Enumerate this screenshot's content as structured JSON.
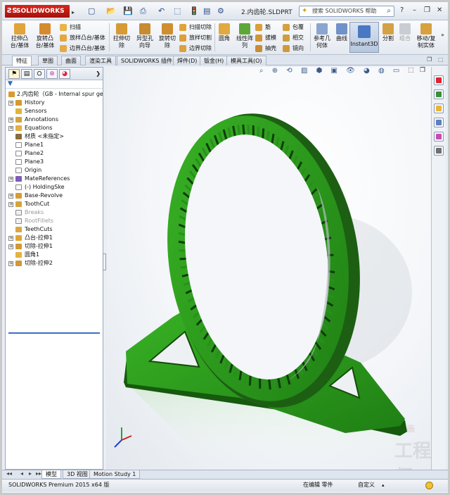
{
  "app": {
    "brand": "SOLIDWORKS",
    "file_title": "2.内齿轮.SLDPRT",
    "search_placeholder": "搜索 SOLIDWORKS 帮助"
  },
  "command_manager": {
    "buttons": [
      {
        "label": "拉伸凸\n台/基体",
        "icon": "extrude-boss-icon"
      },
      {
        "label": "旋转凸\n台/基体",
        "icon": "revolve-boss-icon"
      },
      {
        "label": "扫描",
        "icon": "sweep-icon"
      },
      {
        "label": "放样凸台/基体",
        "icon": "loft-icon"
      },
      {
        "label": "边界凸台/基体",
        "icon": "boundary-boss-icon"
      },
      {
        "label": "拉伸切\n除",
        "icon": "extrude-cut-icon"
      },
      {
        "label": "异型孔\n向导",
        "icon": "hole-wizard-icon"
      },
      {
        "label": "旋转切\n除",
        "icon": "revolve-cut-icon"
      },
      {
        "label": "扫描切除",
        "icon": "swept-cut-icon"
      },
      {
        "label": "放样切割",
        "icon": "lofted-cut-icon"
      },
      {
        "label": "边界切除",
        "icon": "boundary-cut-icon"
      },
      {
        "label": "圆角",
        "icon": "fillet-icon"
      },
      {
        "label": "线性阵\n列",
        "icon": "linear-pattern-icon"
      },
      {
        "label": "筋",
        "icon": "rib-icon"
      },
      {
        "label": "拔模",
        "icon": "draft-icon"
      },
      {
        "label": "抽壳",
        "icon": "shell-icon"
      },
      {
        "label": "包覆",
        "icon": "wrap-icon"
      },
      {
        "label": "相交",
        "icon": "intersect-icon"
      },
      {
        "label": "镜向",
        "icon": "mirror-icon"
      },
      {
        "label": "参考几\n何体",
        "icon": "reference-geometry-icon"
      },
      {
        "label": "曲线",
        "icon": "curves-icon"
      },
      {
        "label": "Instant3D",
        "icon": "instant3d-icon"
      },
      {
        "label": "分割",
        "icon": "split-icon"
      },
      {
        "label": "组合",
        "icon": "combine-icon"
      },
      {
        "label": "移动/复\n制实体",
        "icon": "move-copy-icon"
      }
    ]
  },
  "tabs": [
    "特征",
    "草图",
    "曲面",
    "渲染工具",
    "SOLIDWORKS 插件",
    "焊件(D)",
    "钣金(H)",
    "模具工具(O)"
  ],
  "tree": {
    "root": "2.内齿轮（GB - Internal spur ge",
    "items": [
      {
        "label": "History",
        "icon": "history-icon",
        "expand": true
      },
      {
        "label": "Sensors",
        "icon": "sensor-icon",
        "expand": false
      },
      {
        "label": "Annotations",
        "icon": "annotation-icon",
        "expand": true
      },
      {
        "label": "Equations",
        "icon": "equation-icon",
        "expand": true
      },
      {
        "label": "材质 <未指定>",
        "icon": "material-icon",
        "expand": false
      },
      {
        "label": "Plane1",
        "icon": "plane-icon",
        "expand": false
      },
      {
        "label": "Plane2",
        "icon": "plane-icon",
        "expand": false
      },
      {
        "label": "Plane3",
        "icon": "plane-icon",
        "expand": false
      },
      {
        "label": "Origin",
        "icon": "origin-icon",
        "expand": false
      },
      {
        "label": "MateReferences",
        "icon": "mate-reference-icon",
        "expand": true
      },
      {
        "label": "(-) HoldingSke",
        "icon": "sketch-icon",
        "expand": false
      },
      {
        "label": "Base-Revolve",
        "icon": "revolve-feature-icon",
        "expand": true
      },
      {
        "label": "ToothCut",
        "icon": "cut-feature-icon",
        "expand": true
      },
      {
        "label": "Breaks",
        "icon": "folder-icon",
        "expand": false,
        "suppressed": true
      },
      {
        "label": "RootFillets",
        "icon": "folder-icon",
        "expand": false,
        "suppressed": true
      },
      {
        "label": "TeethCuts",
        "icon": "pattern-feature-icon",
        "expand": false
      },
      {
        "label": "凸台-拉伸1",
        "icon": "extrude-feature-icon",
        "expand": true
      },
      {
        "label": "切除-拉伸1",
        "icon": "cut-extrude-feature-icon",
        "expand": true
      },
      {
        "label": "圆角1",
        "icon": "fillet-feature-icon",
        "expand": false
      },
      {
        "label": "切除-拉伸2",
        "icon": "cut-extrude-feature-icon",
        "expand": true
      }
    ]
  },
  "bottom_tabs": [
    "模型",
    "3D 视图",
    "Motion Study 1"
  ],
  "status": {
    "product": "SOLIDWORKS Premium 2015 x64 版",
    "mode": "在编辑 零件",
    "units": "自定义"
  },
  "watermark": {
    "text": "工程师",
    "small": "画"
  },
  "colors": {
    "gear": "#2e9e1f",
    "gear_dark": "#1a5c12",
    "accent": "#3a6fc6"
  }
}
